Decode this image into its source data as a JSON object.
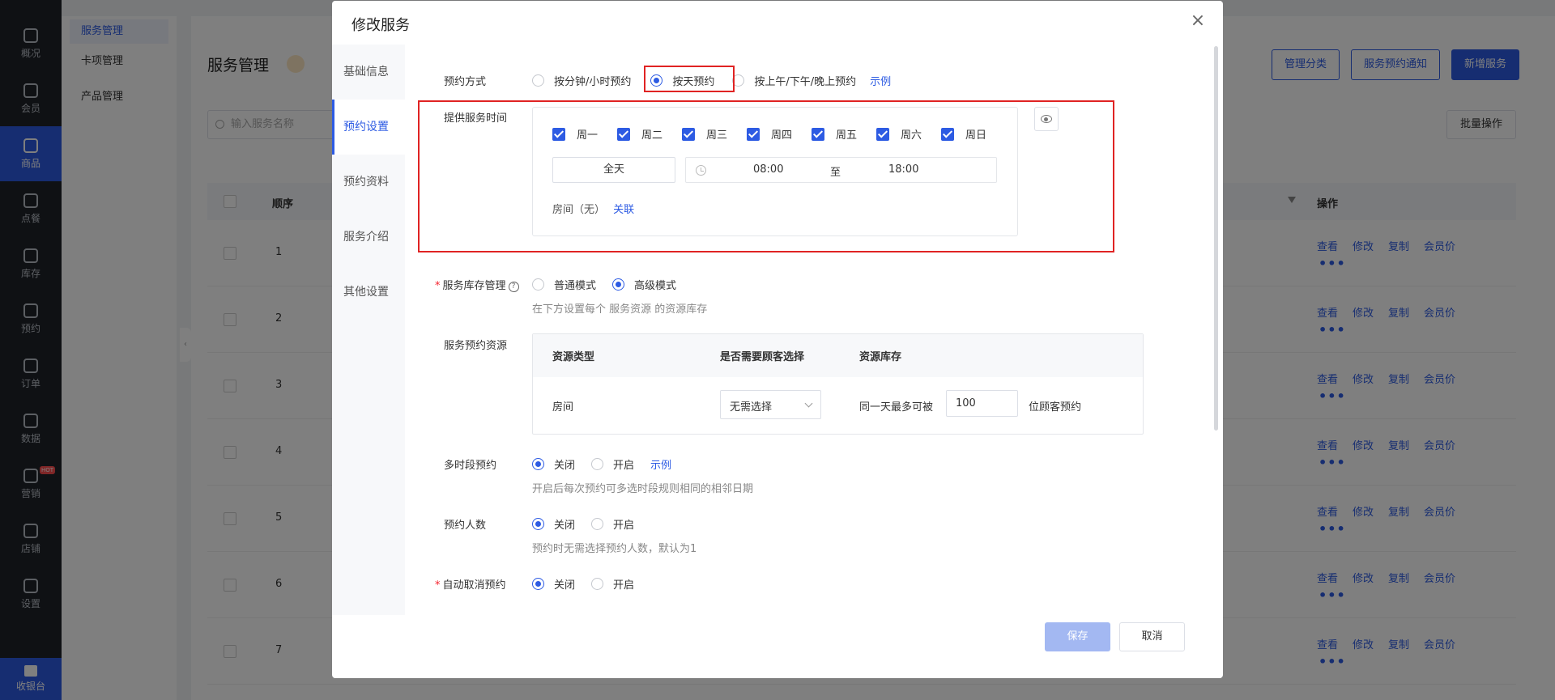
{
  "app": {
    "nav": [
      {
        "label": "概况"
      },
      {
        "label": "会员"
      },
      {
        "label": "商品",
        "active": true
      },
      {
        "label": "点餐"
      },
      {
        "label": "库存"
      },
      {
        "label": "预约"
      },
      {
        "label": "订单"
      },
      {
        "label": "数据"
      },
      {
        "label": "营销",
        "badge": "HOT"
      },
      {
        "label": "店铺"
      },
      {
        "label": "设置"
      }
    ],
    "nav_bottom": "收银台",
    "sub_nav": [
      {
        "label": "服务管理",
        "active": true
      },
      {
        "label": "卡项管理"
      },
      {
        "label": "产品管理"
      }
    ],
    "page_title": "服务管理",
    "header_buttons": [
      "管理分类",
      "服务预约通知",
      "新增服务"
    ],
    "search_placeholder": "输入服务名称",
    "batch_label": "批量操作",
    "table": {
      "col_order": "顺序",
      "col_ops": "操作",
      "row_numbers": [
        "1",
        "2",
        "3",
        "4",
        "5",
        "6",
        "7"
      ],
      "row_actions": [
        "查看",
        "修改",
        "复制",
        "会员价"
      ],
      "more": "•••"
    }
  },
  "modal": {
    "title": "修改服务",
    "close": "×",
    "tabs": [
      "基础信息",
      "预约设置",
      "预约资料",
      "服务介绍",
      "其他设置"
    ],
    "active_tab": "预约设置",
    "booking_method": {
      "label": "预约方式",
      "options": [
        "按分钟/小时预约",
        "按天预约",
        "按上午/下午/晚上预约"
      ],
      "selected": "按天预约",
      "example": "示例"
    },
    "service_time": {
      "label": "提供服务时间",
      "weekdays": [
        "周一",
        "周二",
        "周三",
        "周四",
        "周五",
        "周六",
        "周日"
      ],
      "all_day": "全天",
      "start": "08:00",
      "to": "至",
      "end": "18:00",
      "room_text": "房间（无）",
      "room_link": "关联"
    },
    "inventory": {
      "label": "服务库存管理",
      "help": "?",
      "options": [
        "普通模式",
        "高级模式"
      ],
      "selected": "高级模式",
      "hint": "在下方设置每个 服务资源 的资源库存"
    },
    "resources": {
      "label": "服务预约资源",
      "headers": [
        "资源类型",
        "是否需要顾客选择",
        "资源库存"
      ],
      "row": {
        "type": "房间",
        "select_value": "无需选择",
        "stock_prefix": "同一天最多可被",
        "stock_value": "100",
        "stock_suffix": "位顾客预约"
      }
    },
    "multi_slot": {
      "label": "多时段预约",
      "options": [
        "关闭",
        "开启"
      ],
      "selected": "关闭",
      "example": "示例",
      "hint": "开启后每次预约可多选时段规则相同的相邻日期"
    },
    "people": {
      "label": "预约人数",
      "options": [
        "关闭",
        "开启"
      ],
      "selected": "关闭",
      "hint": "预约时无需选择预约人数，默认为1"
    },
    "auto_cancel": {
      "label": "自动取消预约",
      "options": [
        "关闭",
        "开启"
      ],
      "selected": "关闭"
    },
    "save": "保存",
    "cancel": "取消"
  }
}
